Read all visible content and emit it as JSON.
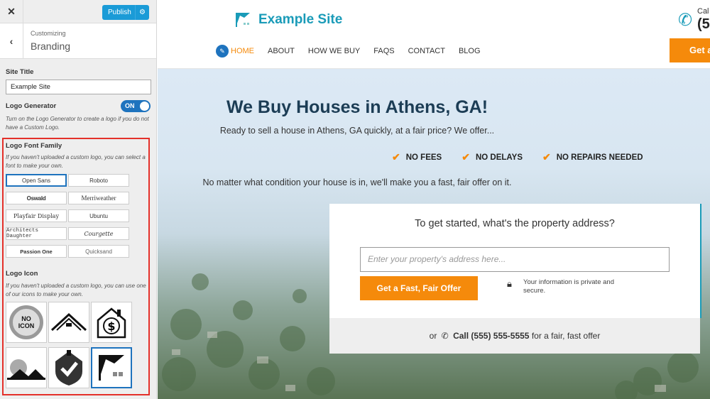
{
  "customizer": {
    "close_icon": "close-icon",
    "publish_label": "Publish",
    "breadcrumb": "Customizing",
    "section_title": "Branding",
    "site_title_label": "Site Title",
    "site_title_value": "Example Site",
    "logo_generator_label": "Logo Generator",
    "logo_generator_toggle": "ON",
    "logo_generator_help": "Turn on the Logo Generator to create a logo if you do not have a Custom Logo.",
    "font_family_label": "Logo Font Family",
    "font_family_help": "If you haven't uploaded a custom logo, you can select a font to make your own.",
    "fonts": [
      "Open Sans",
      "Roboto",
      "Oswald",
      "Merriweather",
      "Playfair Display",
      "Ubuntu",
      "Architects Daughter",
      "Courgette",
      "Passion One",
      "Quicksand"
    ],
    "selected_font": "Open Sans",
    "logo_icon_label": "Logo Icon",
    "logo_icon_help": "If you haven't uploaded a custom logo, you can use one of our icons to make your own.",
    "no_icon_label": "NO ICON",
    "icons": [
      "no-icon",
      "roof-outline-icon",
      "house-dollar-icon",
      "sun-rooftops-icon",
      "shield-check-icon",
      "flag-house-icon"
    ],
    "selected_icon": "flag-house-icon"
  },
  "site": {
    "logo_text": "Example Site",
    "nav": [
      "HOME",
      "ABOUT",
      "HOW WE BUY",
      "FAQS",
      "CONTACT",
      "BLOG"
    ],
    "active_nav": "HOME",
    "call_label": "Cal",
    "call_number": "(5",
    "header_button": "Get a",
    "hero_title": "We Buy Houses in Athens, GA!",
    "hero_subtitle": "Ready to sell a house in Athens, GA quickly, at a fair price? We offer...",
    "features": [
      "NO FEES",
      "NO DELAYS",
      "NO REPAIRS NEEDED"
    ],
    "hero_note": "No matter what condition your house is in, we'll make you a fast, fair offer on it.",
    "form_question": "To get started, what's the property address?",
    "address_placeholder": "Enter your property's address here...",
    "offer_button": "Get a Fast, Fair Offer",
    "privacy_text": "Your information is private and secure.",
    "call_prefix": "or",
    "call_phone": "Call (555) 555-5555",
    "call_suffix": "for a fair, fast offer"
  },
  "colors": {
    "accent_orange": "#f58a0b",
    "brand_teal": "#1a9bb8",
    "customizer_blue": "#1e73be",
    "annotation_red": "#e4302a"
  }
}
